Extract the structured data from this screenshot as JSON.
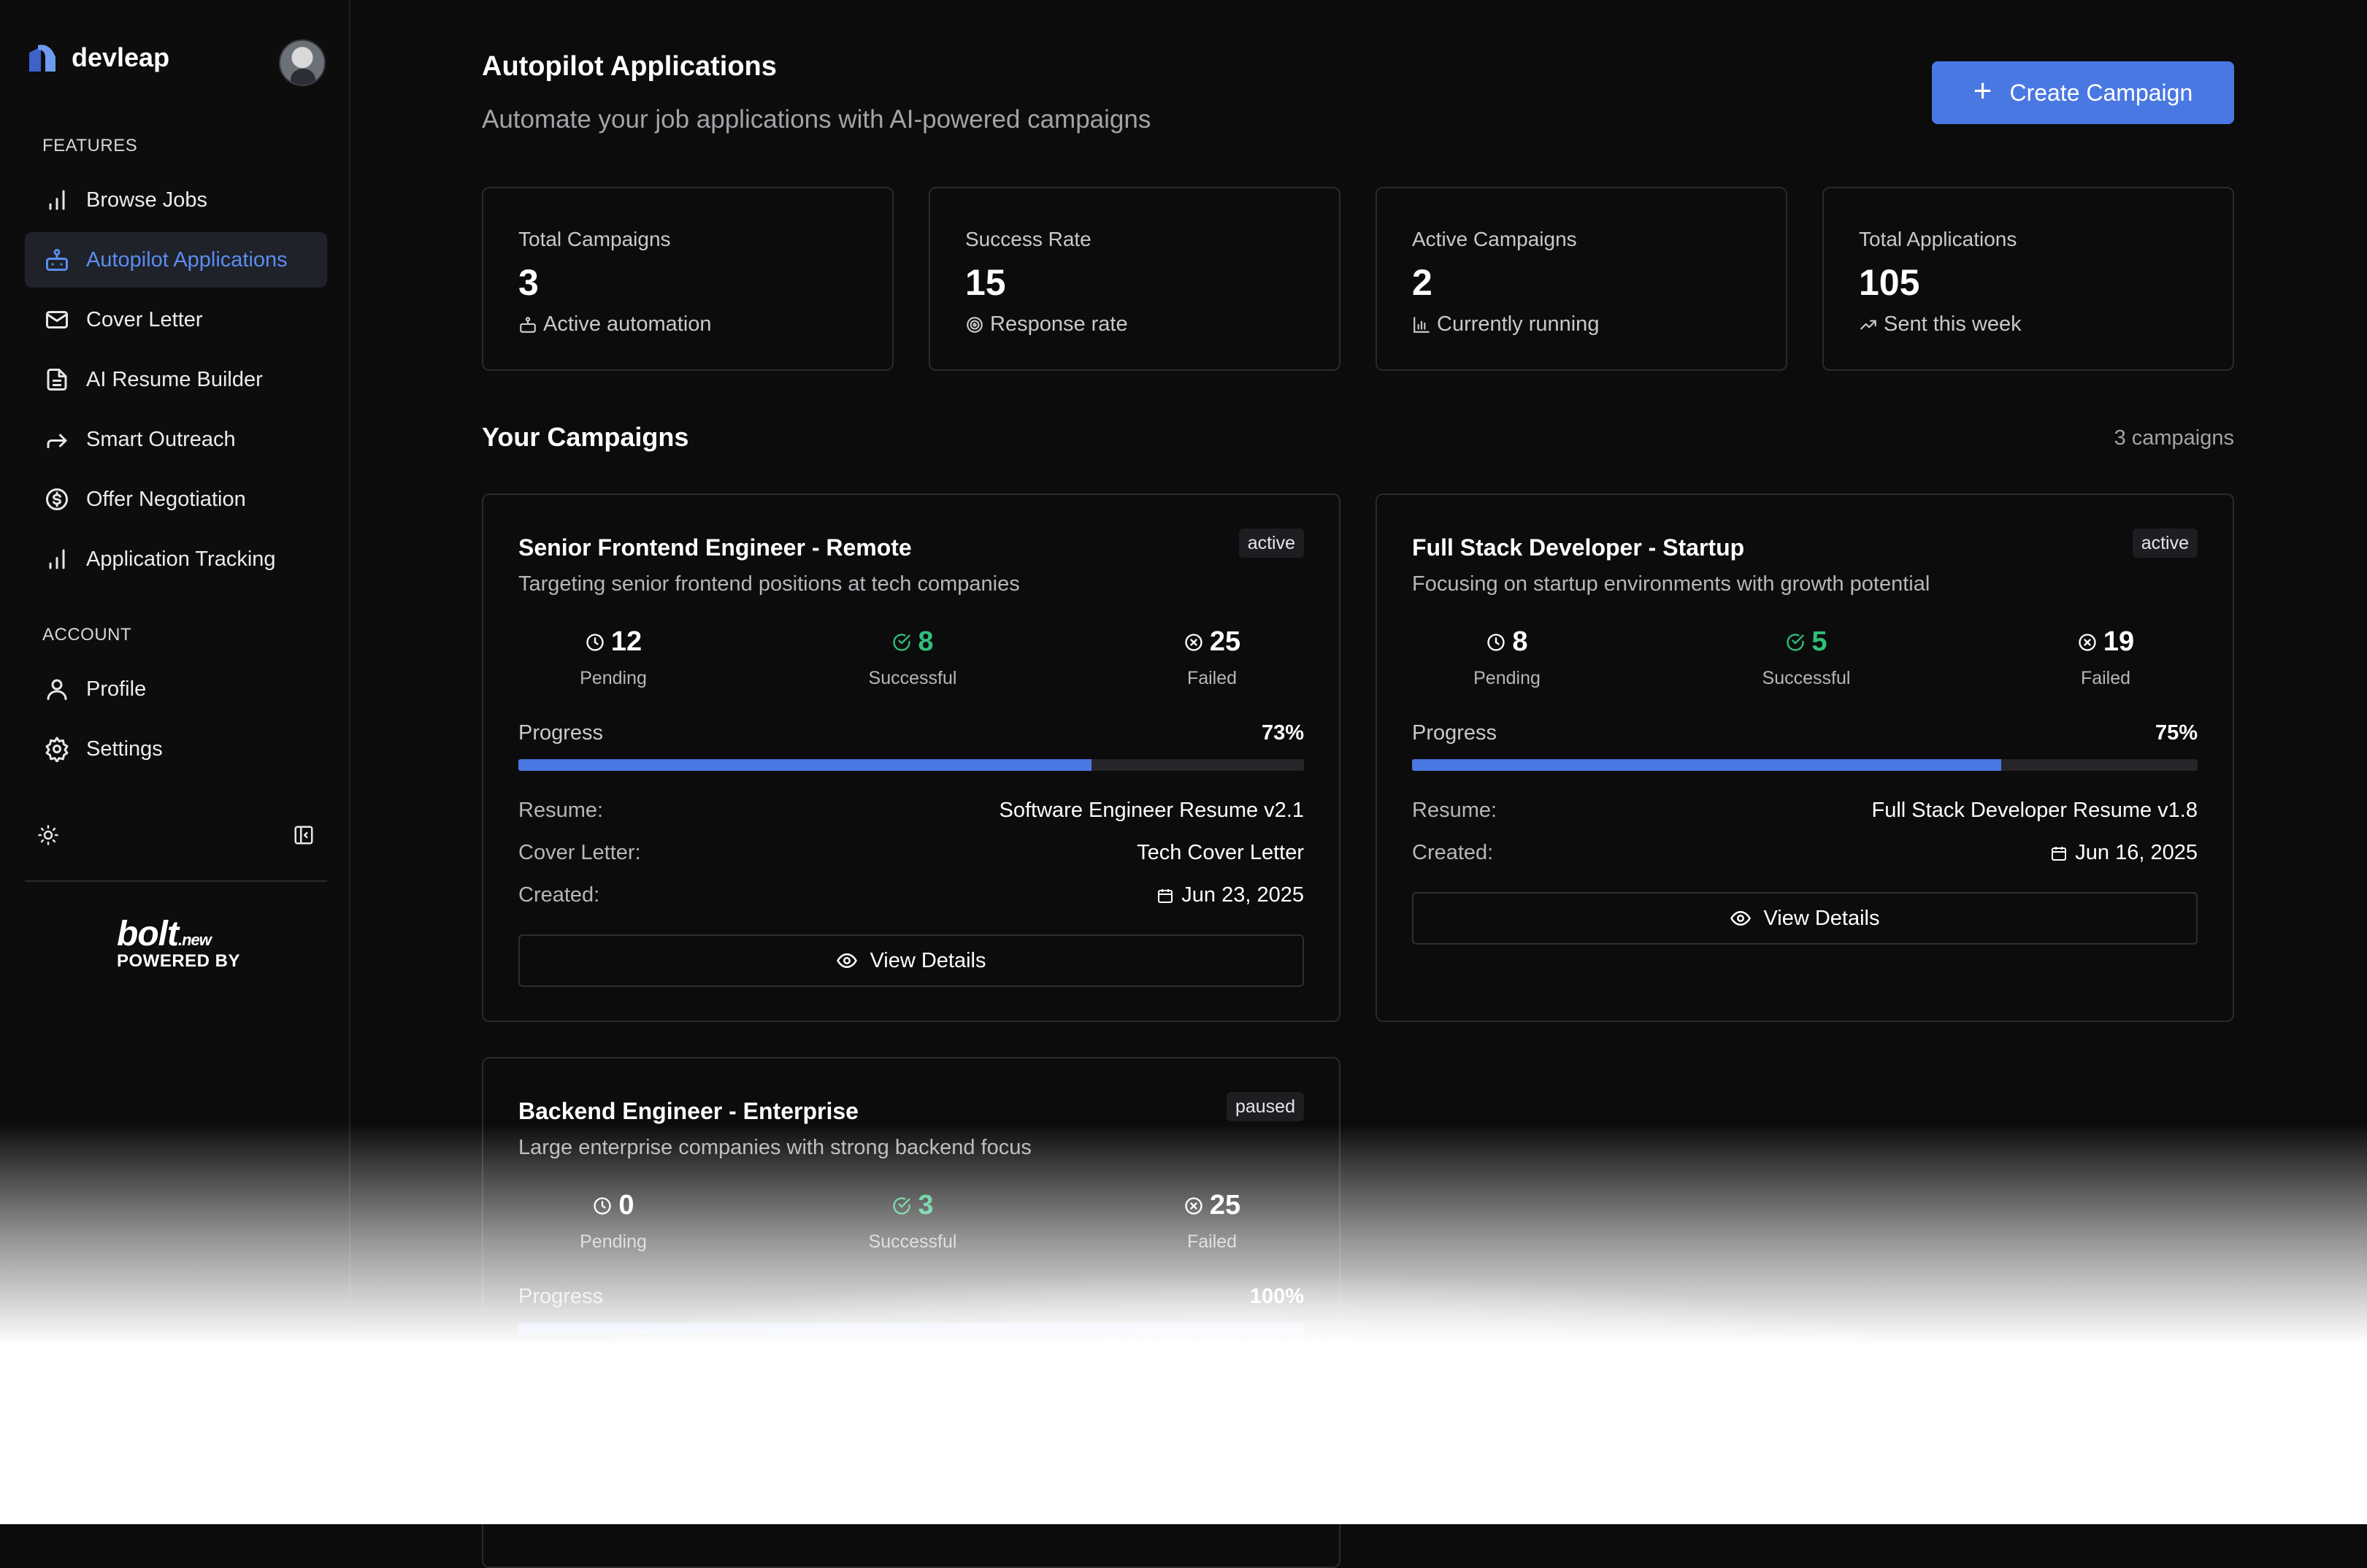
{
  "brand": {
    "name": "devleap"
  },
  "sidebar": {
    "features_title": "FEATURES",
    "account_title": "ACCOUNT",
    "features": [
      {
        "label": "Browse Jobs",
        "icon": "bar-chart-icon"
      },
      {
        "label": "Autopilot Applications",
        "icon": "robot-icon",
        "active": true
      },
      {
        "label": "Cover Letter",
        "icon": "mail-icon"
      },
      {
        "label": "AI Resume Builder",
        "icon": "document-icon"
      },
      {
        "label": "Smart Outreach",
        "icon": "forward-arrow-icon"
      },
      {
        "label": "Offer Negotiation",
        "icon": "dollar-circle-icon"
      },
      {
        "label": "Application Tracking",
        "icon": "bar-chart-icon"
      }
    ],
    "account": [
      {
        "label": "Profile",
        "icon": "user-icon"
      },
      {
        "label": "Settings",
        "icon": "gear-icon"
      }
    ],
    "powered": {
      "word": "bolt",
      "suffix": ".new",
      "caption": "POWERED BY"
    }
  },
  "header": {
    "title": "Autopilot Applications",
    "subtitle": "Automate your job applications with AI-powered campaigns",
    "create_button": "Create Campaign"
  },
  "stats": [
    {
      "label": "Total Campaigns",
      "value": "3",
      "foot": "Active automation",
      "icon": "robot-icon"
    },
    {
      "label": "Success Rate",
      "value": "15",
      "foot": "Response rate",
      "icon": "target-icon"
    },
    {
      "label": "Active Campaigns",
      "value": "2",
      "foot": "Currently running",
      "icon": "bar-chart-icon"
    },
    {
      "label": "Total Applications",
      "value": "105",
      "foot": "Sent this week",
      "icon": "trending-up-icon"
    }
  ],
  "campaigns_section": {
    "title": "Your Campaigns",
    "count": "3 campaigns"
  },
  "campaign_labels": {
    "pending": "Pending",
    "successful": "Successful",
    "failed": "Failed",
    "progress": "Progress",
    "resume": "Resume:",
    "cover_letter": "Cover Letter:",
    "created": "Created:",
    "view_details": "View Details"
  },
  "campaigns": [
    {
      "title": "Senior Frontend Engineer - Remote",
      "status": "active",
      "description": "Targeting senior frontend positions at tech companies",
      "pending": "12",
      "successful": "8",
      "failed": "25",
      "progress": "73%",
      "progress_value": 73,
      "resume": "Software Engineer Resume v2.1",
      "cover_letter": "Tech Cover Letter",
      "created": "Jun 23, 2025"
    },
    {
      "title": "Full Stack Developer - Startup",
      "status": "active",
      "description": "Focusing on startup environments with growth potential",
      "pending": "8",
      "successful": "5",
      "failed": "19",
      "progress": "75%",
      "progress_value": 75,
      "resume": "Full Stack Developer Resume v1.8",
      "created": "Jun 16, 2025"
    },
    {
      "title": "Backend Engineer - Enterprise",
      "status": "paused",
      "description": "Large enterprise companies with strong backend focus",
      "pending": "0",
      "successful": "3",
      "failed": "25",
      "progress": "100%",
      "progress_value": 100
    }
  ],
  "colors": {
    "accent": "#4a78e2",
    "success": "#2fbf7a",
    "background": "#0c0c0d"
  }
}
